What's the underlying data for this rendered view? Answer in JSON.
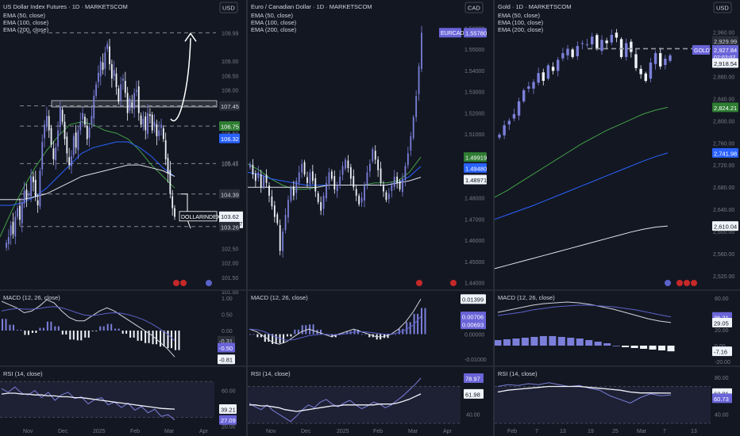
{
  "colors": {
    "bg": "#131722",
    "panel_bg": "#1e222d",
    "divider": "#2a2e39",
    "text": "#d1d4dc",
    "dim": "#787b86",
    "bull": "#7b7fd9",
    "bear": "#f0f3fa",
    "ema50": "#43a047",
    "ema100": "#2962ff",
    "ema200": "#e0e3eb",
    "macd": "#d1d4dc",
    "signal": "#5b62c8",
    "rsi": "#7b7fd9",
    "rsi_ma": "#f0f3fa",
    "tag_green": "#2e7d32",
    "tag_blue": "#2962ff",
    "tag_purple": "#6a64d8",
    "tag_white": "#f0f3fa",
    "tag_dark": "#2a2e39"
  },
  "panels": [
    {
      "id": "dxy",
      "title": "US Dollar Index Futures · 1D · MARKETSCOM",
      "currency": "USD",
      "indicator_lines": [
        "EMA (50, close)",
        "EMA (100, close)",
        "EMA (200, close)"
      ],
      "macd_label": "MACD (12, 26, close)",
      "rsi_label": "RSI (14, close)",
      "symbol_label": "DOLLARINDEX",
      "time_axis": [
        "Nov",
        "Dec",
        "2025",
        "Feb",
        "Mar",
        "Apr"
      ],
      "price_axis": [
        "109.99",
        "109.00",
        "108.50",
        "108.00",
        "107.45",
        "106.75",
        "106.50",
        "106.32",
        "105.47",
        "105.45",
        "104.39",
        "103.62",
        "07:02:07",
        "103.26",
        "102.50",
        "102.00",
        "101.50",
        "101.00"
      ],
      "macd_axis": [
        "1.00",
        "0.50",
        "0.00",
        "-0.31",
        "-0.50",
        "-0.81"
      ],
      "rsi_axis": [
        "60.00",
        "39.21",
        "27.09",
        "20.00"
      ]
    },
    {
      "id": "eurcad",
      "title": "Euro / Canadian Dollar · 1D · MARKETSCOM",
      "currency": "CAD",
      "indicator_lines": [
        "EMA (50, close)",
        "EMA (100, close)",
        "EMA (200, close)"
      ],
      "macd_label": "MACD (12, 26, close)",
      "rsi_label": "RSI (14, close)",
      "symbol_label": "EURCAD",
      "time_axis": [
        "Nov",
        "Dec",
        "2025",
        "Feb",
        "Mar",
        "Apr"
      ],
      "price_axis": [
        "1.56000",
        "1.55780",
        "1.55000",
        "1.54000",
        "1.53000",
        "1.52000",
        "1.51000",
        "1.49919",
        "1.49480",
        "1.48971",
        "1.48000",
        "1.47000",
        "1.46000",
        "1.45000",
        "1.44000"
      ],
      "macd_axis": [
        "0.01399",
        "0.00706",
        "0.00693",
        "0.00000",
        "-0.01000"
      ],
      "rsi_axis": [
        "78.97",
        "61.98",
        "40.00"
      ]
    },
    {
      "id": "gold",
      "title": "Gold · 1D · MARKETSCOM",
      "currency": "USD",
      "indicator_lines": [
        "EMA (50, close)",
        "EMA (100, close)",
        "EMA (200, close)"
      ],
      "macd_label": "MACD (12, 26, close)",
      "rsi_label": "RSI (14, close)",
      "symbol_label": "GOLD",
      "time_axis": [
        "Feb",
        "7",
        "13",
        "19",
        "25",
        "Mar",
        "7",
        "13"
      ],
      "price_axis": [
        "2,960.00",
        "2,929.99",
        "2,927.84",
        "07:02:07",
        "2,918.54",
        "2,880.00",
        "2,840.00",
        "2,824.21",
        "2,800.00",
        "2,760.00",
        "2,741.98",
        "2,720.00",
        "2,680.00",
        "2,640.00",
        "2,610.04",
        "2,600.00",
        "2,560.00",
        "2,520.00"
      ],
      "macd_axis": [
        "60.00",
        "36.21",
        "29.05",
        "20.00",
        "0.00",
        "-7.16",
        "-20.00"
      ],
      "rsi_axis": [
        "80.00",
        "62.81",
        "60.73",
        "40.00"
      ]
    }
  ],
  "chart_data": [
    {
      "type": "candlestick",
      "title": "US Dollar Index Futures · 1D · MARKETSCOM",
      "x": [
        "Nov",
        "Dec",
        "2025",
        "Feb",
        "Mar",
        "Apr"
      ],
      "ylim": [
        101.0,
        110.3
      ],
      "current_price": 103.62,
      "levels": [
        109.99,
        107.45,
        106.75,
        105.45,
        104.39,
        103.26
      ],
      "zone": [
        107.35,
        107.55
      ],
      "series": [
        {
          "name": "EMA (50, close)",
          "values": [
            102.9,
            103.8,
            104.6,
            105.3,
            105.9,
            106.4,
            106.8,
            106.9,
            106.8,
            106.6,
            106.5,
            106.3,
            105.9,
            105.4,
            105.0,
            104.6
          ]
        },
        {
          "name": "EMA (100, close)",
          "values": [
            104.0,
            104.0,
            104.1,
            104.3,
            104.6,
            105.0,
            105.4,
            105.8,
            106.0,
            106.1,
            106.2,
            106.2,
            106.0,
            105.7,
            105.3,
            105.0
          ]
        },
        {
          "name": "EMA (200, close)",
          "values": [
            104.2,
            104.2,
            104.2,
            104.3,
            104.4,
            104.6,
            104.8,
            105.0,
            105.1,
            105.2,
            105.3,
            105.4,
            105.4,
            105.3,
            105.2,
            105.0
          ]
        }
      ],
      "closes": [
        102.7,
        102.9,
        103.3,
        103.0,
        103.6,
        103.9,
        103.5,
        104.1,
        104.5,
        104.2,
        104.4,
        105.0,
        104.8,
        104.3,
        104.0,
        105.2,
        106.2,
        106.8,
        107.1,
        106.6,
        106.1,
        105.6,
        106.0,
        106.6,
        107.4,
        106.9,
        106.3,
        105.8,
        105.4,
        105.7,
        106.4,
        106.0,
        106.6,
        106.9,
        107.2,
        106.8,
        106.3,
        106.7,
        107.1,
        107.8,
        108.2,
        108.6,
        109.0,
        108.7,
        109.3,
        109.6,
        108.9,
        108.4,
        108.7,
        108.1,
        107.6,
        108.2,
        108.4,
        107.9,
        107.2,
        107.7,
        107.4,
        107.9,
        108.0,
        107.2,
        106.8,
        107.0,
        106.6,
        107.2,
        107.1,
        106.6,
        106.9,
        106.4,
        106.6,
        106.8,
        106.3,
        105.6,
        105.1,
        104.4,
        103.9,
        103.6
      ],
      "macd": [
        0.9,
        0.8,
        0.7,
        0.55,
        0.6,
        0.75,
        0.95,
        0.85,
        0.6,
        0.4,
        0.3,
        0.3,
        0.45,
        0.6,
        0.7,
        0.6,
        0.45,
        0.3,
        0.15,
        0.0,
        -0.15,
        -0.35,
        -0.55,
        -0.81
      ],
      "signal": [
        0.6,
        0.65,
        0.68,
        0.66,
        0.66,
        0.68,
        0.72,
        0.74,
        0.7,
        0.63,
        0.55,
        0.48,
        0.46,
        0.49,
        0.53,
        0.55,
        0.53,
        0.48,
        0.41,
        0.32,
        0.2,
        0.06,
        -0.1,
        -0.31
      ],
      "rsi": [
        62,
        58,
        64,
        57,
        55,
        60,
        52,
        58,
        49,
        55,
        58,
        51,
        53,
        45,
        50,
        52,
        44,
        47,
        41,
        46,
        38,
        42,
        35,
        39,
        31,
        33,
        27.09
      ],
      "rsi_ma": [
        56,
        57,
        57,
        56,
        56,
        55,
        55,
        54,
        54,
        53,
        53,
        52,
        52,
        51,
        50,
        49,
        48,
        47,
        46,
        45,
        44,
        43,
        42,
        41,
        40,
        39.5,
        39.21
      ]
    },
    {
      "type": "candlestick",
      "title": "Euro / Canadian Dollar · 1D · MARKETSCOM",
      "x": [
        "Nov",
        "Dec",
        "2025",
        "Feb",
        "Mar",
        "Apr"
      ],
      "ylim": [
        1.438,
        1.562
      ],
      "current_price": 1.5578,
      "closes": [
        1.496,
        1.491,
        1.488,
        1.492,
        1.485,
        1.49,
        1.487,
        1.481,
        1.476,
        1.471,
        1.468,
        1.455,
        1.464,
        1.472,
        1.479,
        1.485,
        1.481,
        1.488,
        1.492,
        1.496,
        1.491,
        1.487,
        1.492,
        1.488,
        1.483,
        1.478,
        1.474,
        1.481,
        1.487,
        1.492,
        1.489,
        1.484,
        1.486,
        1.49,
        1.495,
        1.498,
        1.494,
        1.489,
        1.485,
        1.481,
        1.477,
        1.48,
        1.486,
        1.492,
        1.496,
        1.503,
        1.498,
        1.493,
        1.487,
        1.483,
        1.479,
        1.482,
        1.486,
        1.49,
        1.487,
        1.484,
        1.489,
        1.495,
        1.501,
        1.509,
        1.518,
        1.528,
        1.542,
        1.5578
      ],
      "series": [
        {
          "name": "EMA (50, close)",
          "values": [
            1.496,
            1.493,
            1.489,
            1.486,
            1.484,
            1.484,
            1.485,
            1.486,
            1.486,
            1.486,
            1.486,
            1.487,
            1.487,
            1.488,
            1.492,
            1.4992
          ]
        },
        {
          "name": "EMA (100, close)",
          "values": [
            1.492,
            1.491,
            1.489,
            1.488,
            1.487,
            1.486,
            1.486,
            1.486,
            1.486,
            1.486,
            1.486,
            1.486,
            1.486,
            1.487,
            1.49,
            1.4948
          ]
        },
        {
          "name": "EMA (200, close)",
          "values": [
            1.485,
            1.485,
            1.485,
            1.485,
            1.485,
            1.485,
            1.485,
            1.486,
            1.486,
            1.486,
            1.486,
            1.486,
            1.486,
            1.487,
            1.488,
            1.4897
          ]
        }
      ],
      "macd": [
        0.002,
        0.001,
        -0.001,
        -0.003,
        -0.004,
        -0.003,
        -0.001,
        0.001,
        0.002,
        0.001,
        0.0,
        -0.001,
        0.0,
        0.001,
        0.002,
        0.001,
        0.0,
        -0.001,
        -0.001,
        0.0,
        0.002,
        0.005,
        0.009,
        0.01399
      ],
      "signal": [
        0.002,
        0.0018,
        0.001,
        -0.0004,
        -0.0016,
        -0.0024,
        -0.0022,
        -0.0014,
        -0.0006,
        -0.0002,
        0.0,
        -0.0002,
        -0.0002,
        0.0002,
        0.0008,
        0.001,
        0.0008,
        0.0004,
        0.0,
        0.0,
        0.0006,
        0.0018,
        0.0036,
        0.00706
      ],
      "rsi": [
        52,
        48,
        45,
        50,
        44,
        40,
        36,
        32,
        38,
        45,
        50,
        47,
        53,
        56,
        51,
        48,
        52,
        55,
        50,
        46,
        49,
        53,
        51,
        47,
        50,
        55,
        60,
        66,
        72,
        78.97
      ],
      "rsi_ma": [
        50,
        50,
        49,
        49,
        48,
        47,
        45,
        44,
        43,
        44,
        45,
        46,
        47,
        48,
        49,
        49,
        50,
        50,
        50,
        50,
        50,
        50,
        51,
        51,
        51,
        52,
        54,
        56,
        59,
        61.98
      ]
    },
    {
      "type": "candlestick",
      "title": "Gold · 1D · MARKETSCOM",
      "x": [
        "Feb",
        "7",
        "13",
        "19",
        "25",
        "Mar",
        "7",
        "13"
      ],
      "ylim": [
        2500,
        2975
      ],
      "current_price": 2927.84,
      "levels": [
        2929.99
      ],
      "closes": [
        2775,
        2792,
        2800,
        2812,
        2835,
        2855,
        2862,
        2870,
        2886,
        2872,
        2900,
        2890,
        2910,
        2922,
        2930,
        2915,
        2935,
        2940,
        2938,
        2952,
        2930,
        2946,
        2940,
        2955,
        2950,
        2915,
        2940,
        2924,
        2895,
        2884,
        2872,
        2905,
        2922,
        2898,
        2912,
        2918
      ],
      "series": [
        {
          "name": "EMA (50, close)",
          "values": [
            2662,
            2674,
            2688,
            2702,
            2716,
            2730,
            2744,
            2758,
            2770,
            2782,
            2792,
            2802,
            2812,
            2819,
            2824.21
          ]
        },
        {
          "name": "EMA (100, close)",
          "values": [
            2622,
            2630,
            2638,
            2646,
            2655,
            2664,
            2673,
            2682,
            2691,
            2700,
            2709,
            2718,
            2727,
            2735,
            2741.98
          ]
        },
        {
          "name": "EMA (200, close)",
          "values": [
            2533,
            2539,
            2545,
            2551,
            2557,
            2563,
            2569,
            2575,
            2581,
            2587,
            2593,
            2599,
            2604,
            2608,
            2610.04
          ]
        }
      ],
      "macd": [
        42,
        45,
        48,
        51,
        53,
        54,
        55,
        54,
        52,
        49,
        46,
        42,
        38,
        34,
        31,
        29.05
      ],
      "signal": [
        38,
        40,
        42,
        45,
        47,
        49,
        50,
        51,
        51,
        50,
        49,
        47,
        45,
        42,
        39,
        36.21
      ],
      "histogram": [
        7,
        8,
        9,
        10,
        11,
        12,
        12,
        11,
        10,
        9,
        7,
        5,
        3,
        0,
        -2,
        -3,
        -4,
        -5,
        -6,
        -7.16
      ],
      "rsi": [
        70,
        72,
        71,
        73,
        72,
        74,
        72,
        70,
        71,
        68,
        66,
        60,
        56,
        52,
        58,
        62,
        60,
        60.73
      ],
      "rsi_ma": [
        64,
        66,
        67,
        68,
        69,
        70,
        70,
        70,
        70,
        69,
        68,
        67,
        66,
        64,
        63,
        63,
        62.9,
        62.81
      ]
    }
  ]
}
